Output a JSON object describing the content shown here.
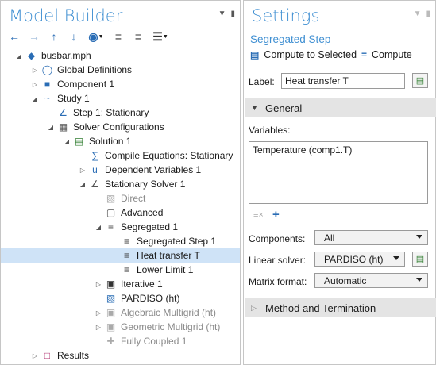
{
  "model_builder": {
    "title": "Model Builder",
    "toolbar": [
      "back-arrow-icon",
      "forward-arrow-icon",
      "move-up-icon",
      "move-down-icon",
      "show-icon",
      "expand-icon",
      "collapse-icon",
      "options-icon"
    ],
    "tree": [
      {
        "label": "busbar.mph",
        "depth": 0,
        "twisty": "open",
        "icon": "model-icon",
        "dim": false,
        "selected": false
      },
      {
        "label": "Global Definitions",
        "depth": 1,
        "twisty": "closed",
        "icon": "globe-icon",
        "dim": false,
        "selected": false
      },
      {
        "label": "Component 1",
        "depth": 1,
        "twisty": "closed",
        "icon": "cube-icon",
        "dim": false,
        "selected": false
      },
      {
        "label": "Study 1",
        "depth": 1,
        "twisty": "open",
        "icon": "study-icon",
        "dim": false,
        "selected": false
      },
      {
        "label": "Step 1: Stationary",
        "depth": 2,
        "twisty": "none",
        "icon": "stationary-step-icon",
        "dim": false,
        "selected": false
      },
      {
        "label": "Solver Configurations",
        "depth": 2,
        "twisty": "open",
        "icon": "solver-configs-icon",
        "dim": false,
        "selected": false
      },
      {
        "label": "Solution 1",
        "depth": 3,
        "twisty": "open",
        "icon": "solution-icon",
        "dim": false,
        "selected": false
      },
      {
        "label": "Compile Equations: Stationary",
        "depth": 4,
        "twisty": "none",
        "icon": "compile-equations-icon",
        "dim": false,
        "selected": false
      },
      {
        "label": "Dependent Variables 1",
        "depth": 4,
        "twisty": "closed",
        "icon": "dependent-variables-icon",
        "dim": false,
        "selected": false
      },
      {
        "label": "Stationary Solver 1",
        "depth": 4,
        "twisty": "open",
        "icon": "stationary-solver-icon",
        "dim": false,
        "selected": false
      },
      {
        "label": "Direct",
        "depth": 5,
        "twisty": "none",
        "icon": "direct-icon",
        "dim": true,
        "selected": false
      },
      {
        "label": "Advanced",
        "depth": 5,
        "twisty": "none",
        "icon": "advanced-icon",
        "dim": false,
        "selected": false
      },
      {
        "label": "Segregated 1",
        "depth": 5,
        "twisty": "open",
        "icon": "segregated-icon",
        "dim": false,
        "selected": false
      },
      {
        "label": "Segregated Step 1",
        "depth": 6,
        "twisty": "none",
        "icon": "segregated-step-icon",
        "dim": false,
        "selected": false
      },
      {
        "label": "Heat transfer T",
        "depth": 6,
        "twisty": "none",
        "icon": "segregated-step-icon",
        "dim": false,
        "selected": true
      },
      {
        "label": "Lower Limit 1",
        "depth": 6,
        "twisty": "none",
        "icon": "lower-limit-icon",
        "dim": false,
        "selected": false
      },
      {
        "label": "Iterative 1",
        "depth": 5,
        "twisty": "closed",
        "icon": "iterative-icon",
        "dim": false,
        "selected": false
      },
      {
        "label": "PARDISO (ht)",
        "depth": 5,
        "twisty": "none",
        "icon": "pardiso-icon",
        "dim": false,
        "selected": false
      },
      {
        "label": "Algebraic Multigrid (ht)",
        "depth": 5,
        "twisty": "closed",
        "icon": "multigrid-icon",
        "dim": true,
        "selected": false
      },
      {
        "label": "Geometric Multigrid (ht)",
        "depth": 5,
        "twisty": "closed",
        "icon": "multigrid-icon",
        "dim": true,
        "selected": false
      },
      {
        "label": "Fully Coupled 1",
        "depth": 5,
        "twisty": "none",
        "icon": "fully-coupled-icon",
        "dim": true,
        "selected": false
      },
      {
        "label": "Results",
        "depth": 1,
        "twisty": "closed",
        "icon": "results-icon",
        "dim": false,
        "selected": false
      }
    ]
  },
  "settings": {
    "title": "Settings",
    "subtitle": "Segregated Step",
    "compute_to_selected": "Compute to Selected",
    "compute": "Compute",
    "label_caption": "Label:",
    "label_value": "Heat transfer T",
    "general_section": "General",
    "variables_caption": "Variables:",
    "variables": [
      "Temperature (comp1.T)"
    ],
    "components_caption": "Components:",
    "components_value": "All",
    "linear_solver_caption": "Linear solver:",
    "linear_solver_value": "PARDISO (ht)",
    "matrix_format_caption": "Matrix format:",
    "matrix_format_value": "Automatic",
    "method_section": "Method and Termination"
  },
  "colors": {
    "accent": "#3f8fd2",
    "selection": "#cfe3f7",
    "section_bg": "#e4e4e4"
  }
}
